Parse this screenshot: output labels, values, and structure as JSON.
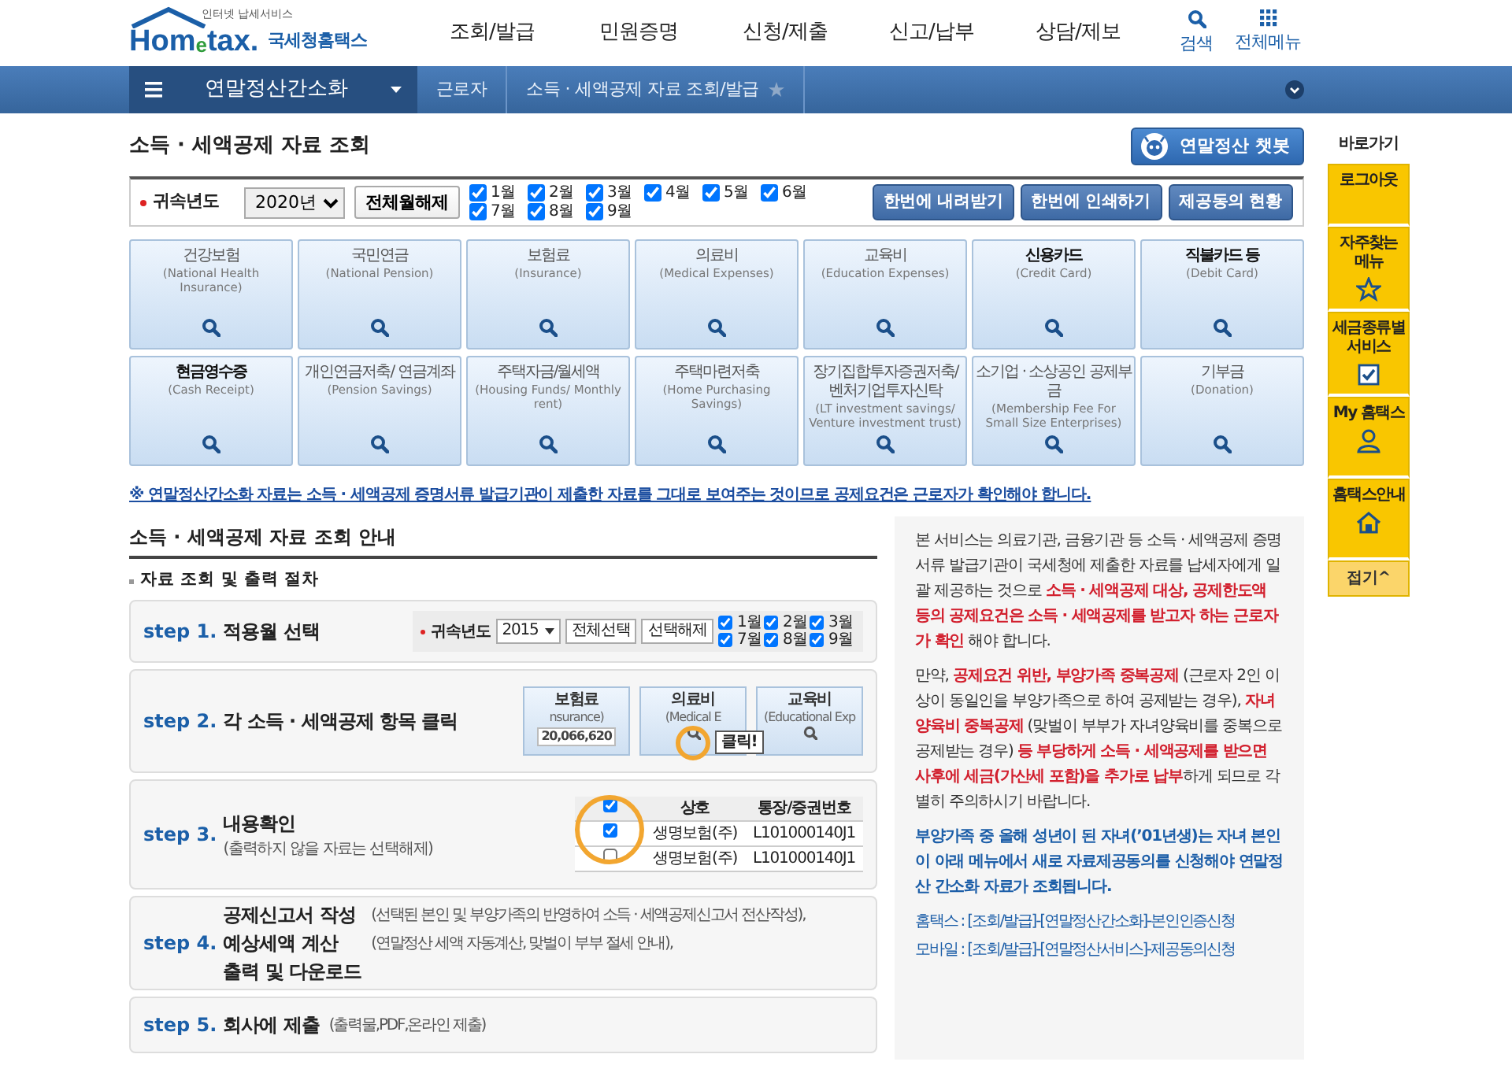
{
  "header": {
    "logo": {
      "tagline": "인터넷 납세서비스",
      "brand": "Hom$_{e}$tax.",
      "korean": "국세청홈택스"
    },
    "nav": [
      "조회/발급",
      "민원증명",
      "신청/제출",
      "신고/납부",
      "상담/제보"
    ],
    "tools": [
      {
        "kind": "search",
        "label": "검색"
      },
      {
        "kind": "grid",
        "label": "전체메뉴"
      }
    ]
  },
  "breadcrumb": {
    "menu": "연말정산간소화",
    "crumbs": [
      "근로자",
      "소득 · 세액공제 자료 조회/발급"
    ],
    "favorite": false
  },
  "page_title": "소득 · 세액공제 자료 조회",
  "chatbot_button": "연말정산 챗봇",
  "filter": {
    "label": "귀속년도",
    "year": "2020년",
    "clear_button": "전체월해제",
    "months": [
      {
        "label": "1월",
        "checked": true
      },
      {
        "label": "2월",
        "checked": true
      },
      {
        "label": "3월",
        "checked": true
      },
      {
        "label": "4월",
        "checked": true
      },
      {
        "label": "5월",
        "checked": true
      },
      {
        "label": "6월",
        "checked": true
      },
      {
        "label": "7월",
        "checked": true
      },
      {
        "label": "8월",
        "checked": true
      },
      {
        "label": "9월",
        "checked": true
      }
    ],
    "actions": [
      "한번에 내려받기",
      "한번에 인쇄하기",
      "제공동의 현황"
    ]
  },
  "categories": [
    {
      "title": "건강보험",
      "subtitle": "(National Health Insurance)",
      "emphasized": false
    },
    {
      "title": "국민연금",
      "subtitle": "(National Pension)",
      "emphasized": false
    },
    {
      "title": "보험료",
      "subtitle": "(Insurance)",
      "emphasized": false
    },
    {
      "title": "의료비",
      "subtitle": "(Medical Expenses)",
      "emphasized": false
    },
    {
      "title": "교육비",
      "subtitle": "(Education Expenses)",
      "emphasized": false
    },
    {
      "title": "신용카드",
      "subtitle": "(Credit Card)",
      "emphasized": true
    },
    {
      "title": "직불카드 등",
      "subtitle": "(Debit Card)",
      "emphasized": true
    },
    {
      "title": "현금영수증",
      "subtitle": "(Cash Receipt)",
      "emphasized": true
    },
    {
      "title": "개인연금저축/ 연금계좌",
      "subtitle": "(Pension Savings)",
      "emphasized": false
    },
    {
      "title": "주택자금/월세액",
      "subtitle": "(Housing Funds/ Monthly rent)",
      "emphasized": false
    },
    {
      "title": "주택마련저축",
      "subtitle": "(Home Purchasing Savings)",
      "emphasized": false
    },
    {
      "title": "장기집합투자증권저축/ 벤처기업투자신탁",
      "subtitle": "(LT investment savings/ Venture investment trust)",
      "emphasized": false
    },
    {
      "title": "소기업 · 소상공인 공제부금",
      "subtitle": "(Membership Fee For Small Size Enterprises)",
      "emphasized": false
    },
    {
      "title": "기부금",
      "subtitle": "(Donation)",
      "emphasized": false
    }
  ],
  "notice": "※ 연말정산간소화 자료는 소득 · 세액공제 증명서류 발급기관이 제출한 자료를 그대로 보여주는 것이므로 공제요건은 근로자가 확인해야 합니다.",
  "guide": {
    "title": "소득 · 세액공제 자료 조회 안내",
    "subtitle": "자료 조회 및 출력 절차",
    "steps": [
      {
        "number": "step 1.",
        "lines": [
          {
            "title": "적용월 선택"
          }
        ],
        "mockup": {
          "kind": "form",
          "label": "귀속년도",
          "year": "2015",
          "buttons": [
            "전체선택",
            "선택해제"
          ],
          "months": [
            {
              "label": "1월",
              "checked": true
            },
            {
              "label": "2월",
              "checked": true
            },
            {
              "label": "3월",
              "checked": true
            },
            {
              "label": "7월",
              "checked": true
            },
            {
              "label": "8월",
              "checked": true
            },
            {
              "label": "9월",
              "checked": true
            }
          ]
        }
      },
      {
        "number": "step 2.",
        "lines": [
          {
            "title": "각 소득 · 세액공제 항목 클릭"
          }
        ],
        "mockup": {
          "kind": "cards",
          "tooltip": "클릭!",
          "cards": [
            {
              "title": "보험료",
              "subtitle": "nsurance)",
              "amount": "20,066,620",
              "selected": false
            },
            {
              "title": "의료비",
              "subtitle": "(Medical E",
              "selected": true
            },
            {
              "title": "교육비",
              "subtitle": "(Educational Exp",
              "selected": false
            }
          ]
        }
      },
      {
        "number": "step 3.",
        "lines": [
          {
            "title": "내용확인"
          }
        ],
        "caption": "(출력하지 않을 자료는 선택해제)",
        "mockup": {
          "kind": "table",
          "header_checked": true,
          "columns": [
            "상호",
            "통장/증권번호"
          ],
          "rows": [
            {
              "checked": true,
              "cells": [
                "생명보험(주)",
                "L101000140J1"
              ]
            },
            {
              "checked": false,
              "cells": [
                "생명보험(주)",
                "L101000140J1"
              ]
            }
          ]
        }
      },
      {
        "number": "step 4.",
        "lines": [
          {
            "title": "공제신고서 작성",
            "note": "(선택된 본인 및 부양가족의 반영하여 소득 · 세액공제신고서 전산작성),"
          },
          {
            "title": "예상세액 계산",
            "note": "(연말정산 세액 자동계산, 맞벌이 부부 절세 안내),"
          },
          {
            "title": "출력 및 다운로드"
          }
        ]
      },
      {
        "number": "step 5.",
        "lines": [
          {
            "title": "회사에 제출",
            "note": "(출력물,PDF,온라인 제출)"
          }
        ]
      }
    ]
  },
  "info": {
    "paragraphs": [
      [
        {
          "text": "본 서비스는 의료기관, 금융기관 등 소득 · 세액공제 증명서류 발급기관이 국세청에 제출한 자료를 납세자에게 일괄 제공하는 것으로 ",
          "emphasis": false
        },
        {
          "text": "소득 · 세액공제 대상, 공제한도액 등의 공제요건은 소득 · 세액공제를 받고자 하는 근로자가 확인",
          "emphasis": true
        },
        {
          "text": " 해야 합니다.",
          "emphasis": false
        }
      ],
      [
        {
          "text": "만약, ",
          "emphasis": false
        },
        {
          "text": "공제요건 위반, 부양가족 중복공제",
          "emphasis": true
        },
        {
          "text": " (근로자 2인 이상이 동일인을 부양가족으로 하여 공제받는 경우), ",
          "emphasis": false
        },
        {
          "text": "자녀양육비 중복공제",
          "emphasis": true
        },
        {
          "text": " (맞벌이 부부가 자녀양육비를 중복으로 공제받는 경우) ",
          "emphasis": false
        },
        {
          "text": "등 부당하게 소득 · 세액공제를 받으면 사후에 세금(가산세 포함)을 추가로 납부",
          "emphasis": true
        },
        {
          "text": "하게 되므로 각별히 주의하시기 바랍니다.",
          "emphasis": false
        }
      ]
    ],
    "notice": "부양가족 중 올해 성년이 된 자녀(’01년생)는 자녀 본인이 아래 메뉴에서 새로 자료제공동의를 신청해야 연말정산 간소화 자료가 조회됩니다.",
    "paths": [
      "홈택스 : [조회/발급]-[연말정산간소화]-본인인증신청",
      "모바일 : [조회/발급]-[연말정산서비스]-제공동의신청"
    ]
  },
  "quick": {
    "title": "바로가기",
    "items": [
      {
        "kind": "logout",
        "label": "로그아웃"
      },
      {
        "kind": "star",
        "label": "자주찾는 메뉴"
      },
      {
        "kind": "check",
        "label": "세금종류별 서비스"
      },
      {
        "kind": "person",
        "label": "My 홈택스"
      },
      {
        "kind": "house",
        "label": "홈택스안내"
      }
    ],
    "collapse": "접기^"
  }
}
